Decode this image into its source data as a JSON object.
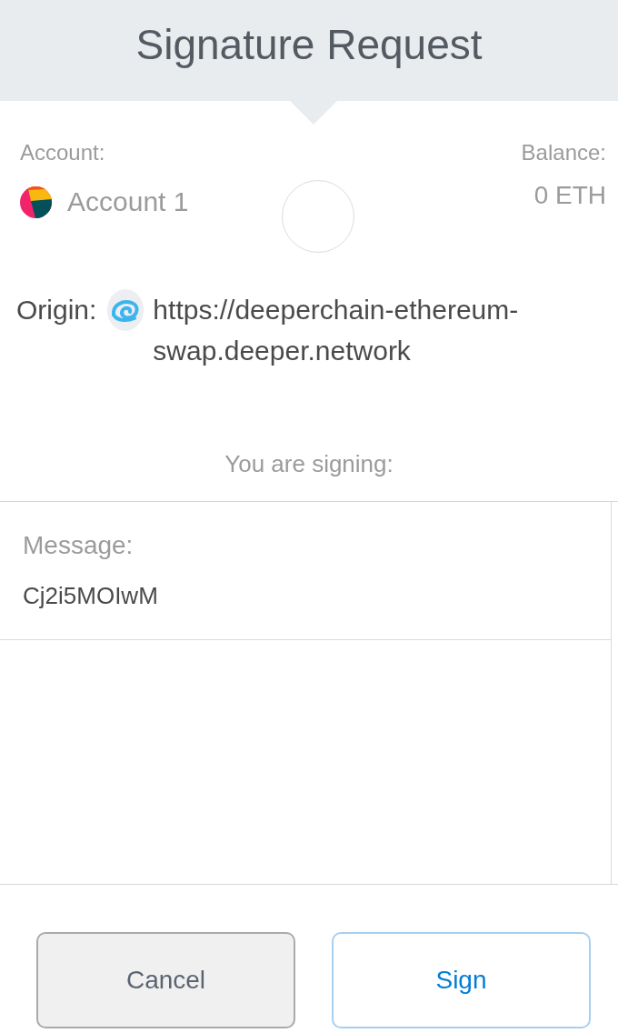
{
  "header": {
    "title": "Signature Request"
  },
  "account": {
    "label": "Account:",
    "name": "Account 1"
  },
  "balance": {
    "label": "Balance:",
    "value": "0 ETH"
  },
  "origin": {
    "label": "Origin:",
    "url": "https://deeperchain-ethereum-swap.deeper.network"
  },
  "signing_label": "You are signing:",
  "message": {
    "label": "Message:",
    "value": "Cj2i5MOIwM"
  },
  "buttons": [
    {
      "kind": "cancel",
      "label": "Cancel"
    },
    {
      "kind": "sign",
      "label": "Sign"
    }
  ]
}
